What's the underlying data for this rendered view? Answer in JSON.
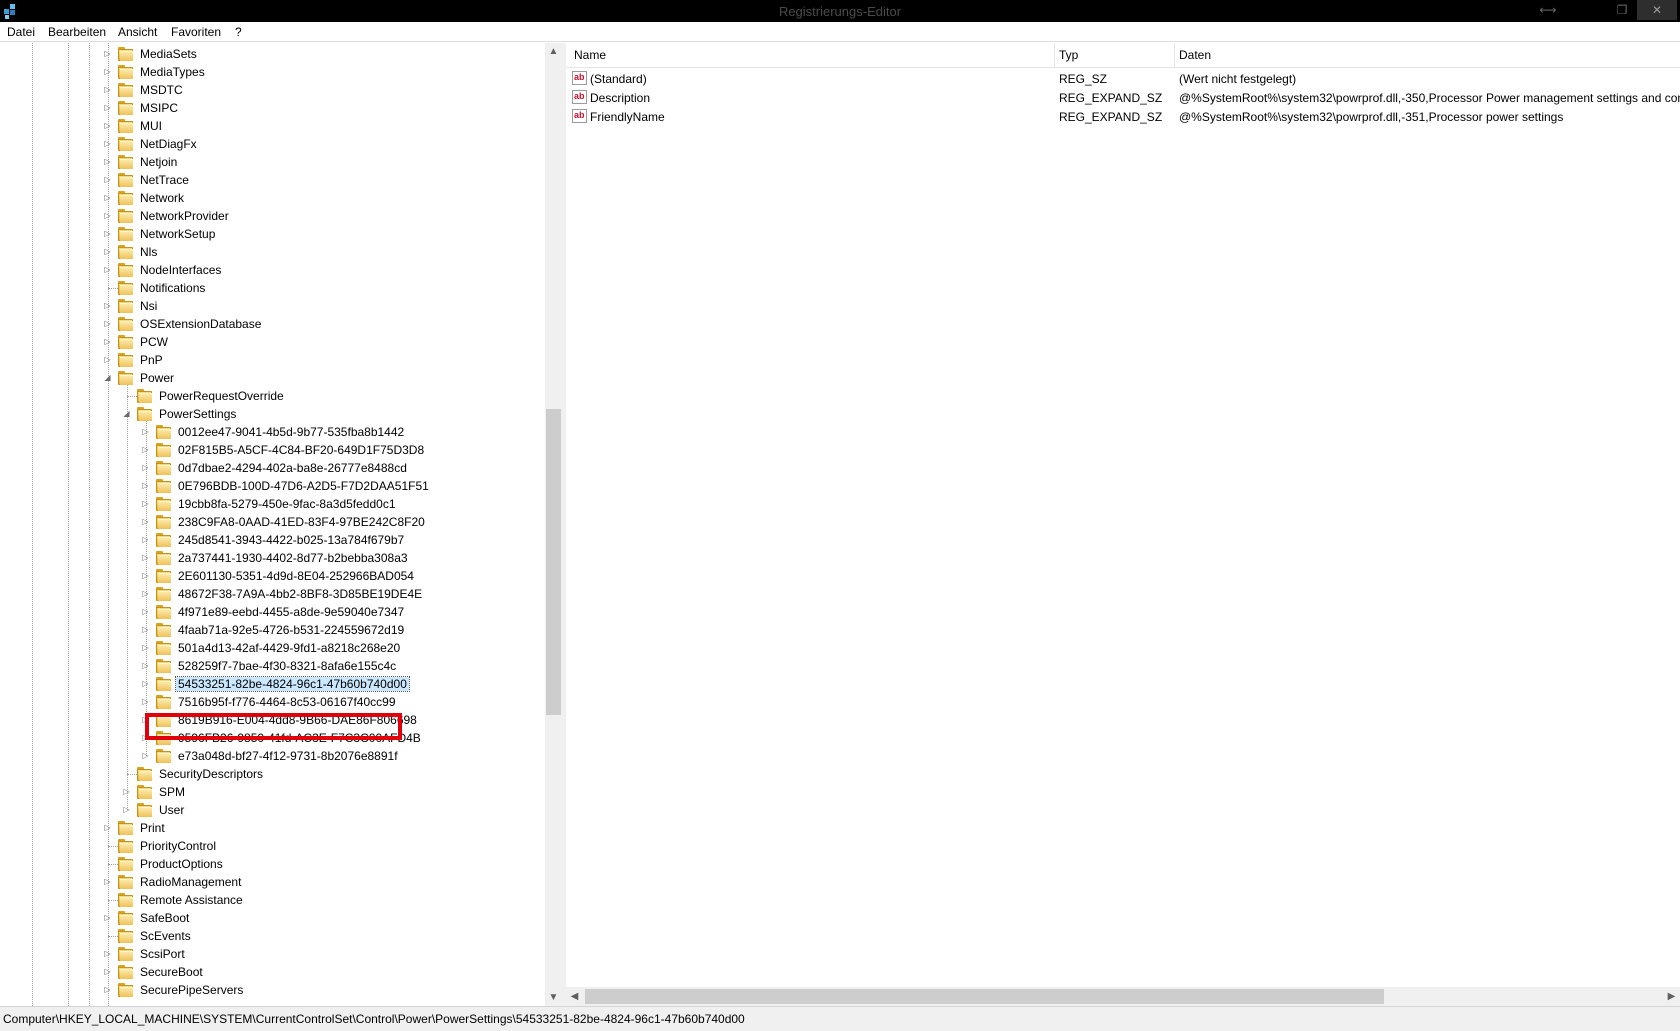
{
  "window": {
    "title": "Registrierungs-Editor",
    "min_glyph": "⟷",
    "max_glyph": "❐",
    "close_glyph": "✕"
  },
  "menu": [
    "Datei",
    "Bearbeiten",
    "Ansicht",
    "Favoriten",
    "?"
  ],
  "tree": {
    "items": [
      {
        "label": "MediaSets",
        "level": 0,
        "expander": "collapsed"
      },
      {
        "label": "MediaTypes",
        "level": 0,
        "expander": "collapsed"
      },
      {
        "label": "MSDTC",
        "level": 0,
        "expander": "collapsed"
      },
      {
        "label": "MSIPC",
        "level": 0,
        "expander": "collapsed"
      },
      {
        "label": "MUI",
        "level": 0,
        "expander": "collapsed"
      },
      {
        "label": "NetDiagFx",
        "level": 0,
        "expander": "collapsed"
      },
      {
        "label": "Netjoin",
        "level": 0,
        "expander": "collapsed"
      },
      {
        "label": "NetTrace",
        "level": 0,
        "expander": "collapsed"
      },
      {
        "label": "Network",
        "level": 0,
        "expander": "collapsed"
      },
      {
        "label": "NetworkProvider",
        "level": 0,
        "expander": "collapsed"
      },
      {
        "label": "NetworkSetup",
        "level": 0,
        "expander": "collapsed"
      },
      {
        "label": "Nls",
        "level": 0,
        "expander": "collapsed"
      },
      {
        "label": "NodeInterfaces",
        "level": 0,
        "expander": "collapsed"
      },
      {
        "label": "Notifications",
        "level": 0,
        "expander": "none"
      },
      {
        "label": "Nsi",
        "level": 0,
        "expander": "collapsed"
      },
      {
        "label": "OSExtensionDatabase",
        "level": 0,
        "expander": "collapsed"
      },
      {
        "label": "PCW",
        "level": 0,
        "expander": "collapsed"
      },
      {
        "label": "PnP",
        "level": 0,
        "expander": "collapsed"
      },
      {
        "label": "Power",
        "level": 0,
        "expander": "expanded"
      },
      {
        "label": "PowerRequestOverride",
        "level": 1,
        "expander": "none"
      },
      {
        "label": "PowerSettings",
        "level": 1,
        "expander": "expanded"
      },
      {
        "label": "0012ee47-9041-4b5d-9b77-535fba8b1442",
        "level": 2,
        "expander": "collapsed"
      },
      {
        "label": "02F815B5-A5CF-4C84-BF20-649D1F75D3D8",
        "level": 2,
        "expander": "collapsed"
      },
      {
        "label": "0d7dbae2-4294-402a-ba8e-26777e8488cd",
        "level": 2,
        "expander": "collapsed"
      },
      {
        "label": "0E796BDB-100D-47D6-A2D5-F7D2DAA51F51",
        "level": 2,
        "expander": "collapsed"
      },
      {
        "label": "19cbb8fa-5279-450e-9fac-8a3d5fedd0c1",
        "level": 2,
        "expander": "collapsed"
      },
      {
        "label": "238C9FA8-0AAD-41ED-83F4-97BE242C8F20",
        "level": 2,
        "expander": "collapsed"
      },
      {
        "label": "245d8541-3943-4422-b025-13a784f679b7",
        "level": 2,
        "expander": "collapsed"
      },
      {
        "label": "2a737441-1930-4402-8d77-b2bebba308a3",
        "level": 2,
        "expander": "collapsed"
      },
      {
        "label": "2E601130-5351-4d9d-8E04-252966BAD054",
        "level": 2,
        "expander": "collapsed"
      },
      {
        "label": "48672F38-7A9A-4bb2-8BF8-3D85BE19DE4E",
        "level": 2,
        "expander": "collapsed"
      },
      {
        "label": "4f971e89-eebd-4455-a8de-9e59040e7347",
        "level": 2,
        "expander": "collapsed"
      },
      {
        "label": "4faab71a-92e5-4726-b531-224559672d19",
        "level": 2,
        "expander": "collapsed"
      },
      {
        "label": "501a4d13-42af-4429-9fd1-a8218c268e20",
        "level": 2,
        "expander": "collapsed"
      },
      {
        "label": "528259f7-7bae-4f30-8321-8afa6e155c4c",
        "level": 2,
        "expander": "collapsed"
      },
      {
        "label": "54533251-82be-4824-96c1-47b60b740d00",
        "level": 2,
        "expander": "collapsed",
        "selected": true
      },
      {
        "label": "7516b95f-f776-4464-8c53-06167f40cc99",
        "level": 2,
        "expander": "collapsed"
      },
      {
        "label": "8619B916-E004-4dd8-9B66-DAE86F806698",
        "level": 2,
        "expander": "collapsed"
      },
      {
        "label": "9596FB26-9850-41fd-AC3E-F7C3C00AFD4B",
        "level": 2,
        "expander": "collapsed"
      },
      {
        "label": "e73a048d-bf27-4f12-9731-8b2076e8891f",
        "level": 2,
        "expander": "collapsed"
      },
      {
        "label": "SecurityDescriptors",
        "level": 1,
        "expander": "none"
      },
      {
        "label": "SPM",
        "level": 1,
        "expander": "collapsed"
      },
      {
        "label": "User",
        "level": 1,
        "expander": "collapsed"
      },
      {
        "label": "Print",
        "level": 0,
        "expander": "collapsed"
      },
      {
        "label": "PriorityControl",
        "level": 0,
        "expander": "none"
      },
      {
        "label": "ProductOptions",
        "level": 0,
        "expander": "none"
      },
      {
        "label": "RadioManagement",
        "level": 0,
        "expander": "collapsed"
      },
      {
        "label": "Remote Assistance",
        "level": 0,
        "expander": "none"
      },
      {
        "label": "SafeBoot",
        "level": 0,
        "expander": "collapsed"
      },
      {
        "label": "ScEvents",
        "level": 0,
        "expander": "none"
      },
      {
        "label": "ScsiPort",
        "level": 0,
        "expander": "collapsed"
      },
      {
        "label": "SecureBoot",
        "level": 0,
        "expander": "collapsed"
      },
      {
        "label": "SecurePipeServers",
        "level": 0,
        "expander": "collapsed"
      }
    ]
  },
  "list": {
    "columns": [
      "Name",
      "Typ",
      "Daten"
    ],
    "rows": [
      {
        "name": "(Standard)",
        "type": "REG_SZ",
        "data": "(Wert nicht festgelegt)"
      },
      {
        "name": "Description",
        "type": "REG_EXPAND_SZ",
        "data": "@%SystemRoot%\\system32\\powrprof.dll,-350,Processor Power management settings and con"
      },
      {
        "name": "FriendlyName",
        "type": "REG_EXPAND_SZ",
        "data": "@%SystemRoot%\\system32\\powrprof.dll,-351,Processor power settings"
      }
    ],
    "value_icon_text": "ab"
  },
  "status": {
    "path": "Computer\\HKEY_LOCAL_MACHINE\\SYSTEM\\CurrentControlSet\\Control\\Power\\PowerSettings\\54533251-82be-4824-96c1-47b60b740d00"
  },
  "glyphs": {
    "scroll_up": "▲",
    "scroll_down": "▼",
    "scroll_left": "◀",
    "scroll_right": "▶",
    "expand_collapsed": "▷",
    "expand_expanded": "◢"
  },
  "colors": {
    "highlight": "#e0000c",
    "selection": "#cce8ff"
  }
}
